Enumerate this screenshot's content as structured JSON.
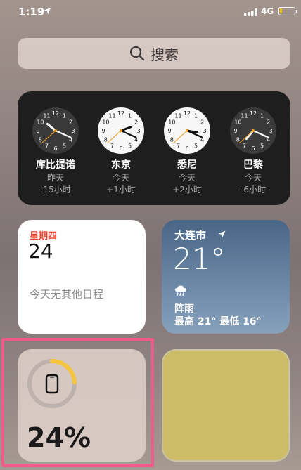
{
  "status_bar": {
    "time": "1:19",
    "network": "4G",
    "battery_level": 0.15,
    "battery_fill_color": "#f5c200"
  },
  "search": {
    "label": "搜索"
  },
  "world_clock": {
    "clocks": [
      {
        "city": "库比提诺",
        "day": "昨天",
        "offset": "-15小时",
        "face": "dark",
        "hour_hand": "10:19",
        "minute": 19
      },
      {
        "city": "东京",
        "day": "今天",
        "offset": "+1小时",
        "face": "light",
        "hour_hand": "2:19",
        "minute": 19
      },
      {
        "city": "悉尼",
        "day": "今天",
        "offset": "+2小时",
        "face": "light",
        "hour_hand": "3:19",
        "minute": 19
      },
      {
        "city": "巴黎",
        "day": "今天",
        "offset": "-6小时",
        "face": "dark",
        "hour_hand": "7:19",
        "minute": 19
      }
    ]
  },
  "calendar": {
    "weekday": "星期四",
    "date": "24",
    "events_text": "今天无其他日程"
  },
  "weather": {
    "city": "大连市",
    "temperature": "21°",
    "condition": "阵雨",
    "range": "最高 21° 最低 16°"
  },
  "battery_widget": {
    "percent_text": "24%",
    "level": 0.24,
    "ring_color": "#f5c542"
  },
  "colors": {
    "highlight": "#ee5c8d",
    "calendar_accent": "#e8432f",
    "photo_fill": "#cdbd68"
  }
}
